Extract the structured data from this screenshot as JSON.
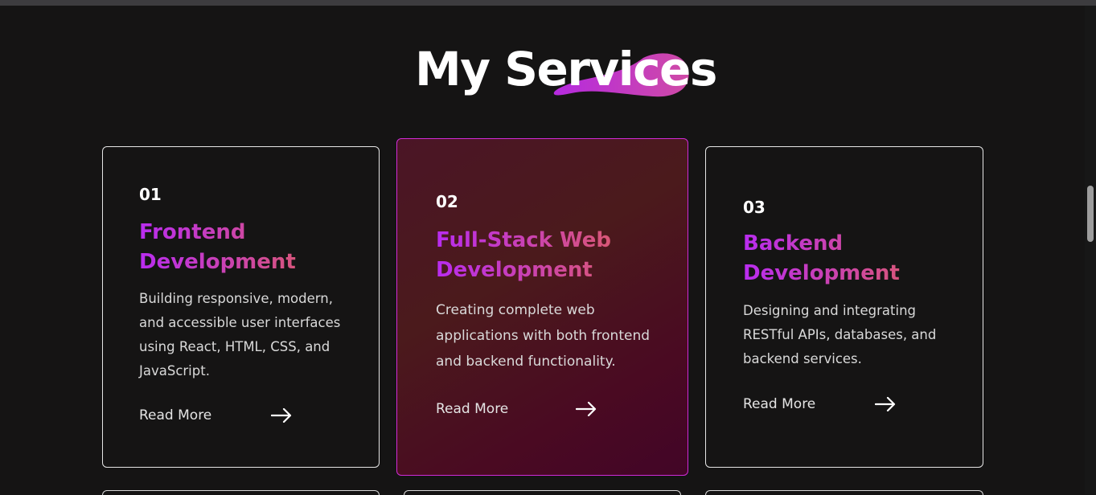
{
  "section": {
    "title": "My Services",
    "accent_colors": [
      "#b92cf0",
      "#d04a9a",
      "#e2654e"
    ]
  },
  "services": [
    {
      "number": "01",
      "title": "Frontend Development",
      "description": "Building responsive, modern, and accessible user interfaces using React, HTML, CSS, and JavaScript.",
      "link_label": "Read More",
      "link_icon": "arrow-right-icon"
    },
    {
      "number": "02",
      "title": "Full-Stack Web Development",
      "description": "Creating complete web applications with both frontend and backend functionality.",
      "link_label": "Read More",
      "link_icon": "arrow-right-icon",
      "highlighted": true
    },
    {
      "number": "03",
      "title": "Backend Development",
      "description": "Designing and integrating RESTful APIs, databases, and backend services.",
      "link_label": "Read More",
      "link_icon": "arrow-right-icon"
    }
  ]
}
